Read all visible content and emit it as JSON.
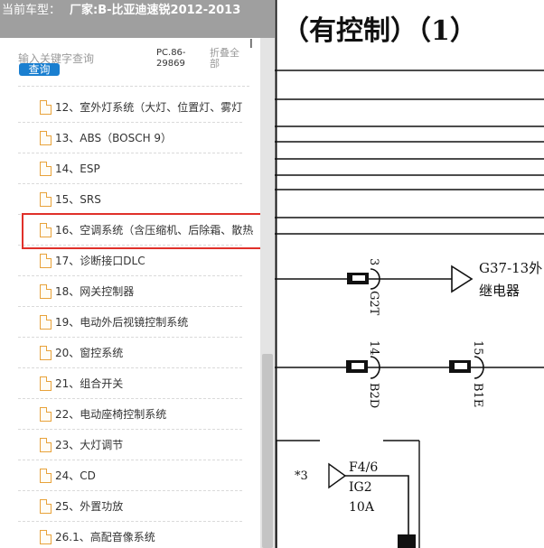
{
  "window": {
    "title_prefix": "当前车型：",
    "car_model": "厂家:B-比亚迪速锐2012-2013"
  },
  "search": {
    "placeholder": "输入关键字查询",
    "button_label": "查询",
    "pc_code": "PC.86-29869",
    "collapse_all": "折叠全部",
    "bar_glyph": "I"
  },
  "tree_items": [
    {
      "label": "12、室外灯系统（大灯、位置灯、雾灯"
    },
    {
      "label": "13、ABS（BOSCH 9）"
    },
    {
      "label": "14、ESP"
    },
    {
      "label": "15、SRS"
    },
    {
      "label": "16、空调系统（含压缩机、后除霜、散热"
    },
    {
      "label": "17、诊断接口DLC"
    },
    {
      "label": "18、网关控制器"
    },
    {
      "label": "19、电动外后视镜控制系统"
    },
    {
      "label": "20、窗控系统"
    },
    {
      "label": "21、组合开关"
    },
    {
      "label": "22、电动座椅控制系统"
    },
    {
      "label": "23、大灯调节"
    },
    {
      "label": "24、CD"
    },
    {
      "label": "25、外置功放"
    },
    {
      "label": "26.1、高配音像系统"
    }
  ],
  "selected_index": 4,
  "colors": {
    "title_bar": "#9f9f9f",
    "search_button": "#1a7fd0",
    "highlight": "#e0302a",
    "doc_icon": "#e8a23a"
  },
  "diagram": {
    "header_fragment": "（有控制）（1）",
    "pin_3": "3",
    "pin_14": "14",
    "pin_15": "15",
    "conn_g2t": "G2T",
    "conn_b2d": "B2D",
    "conn_b1e": "B1E",
    "relay_label_1": "G37-13外",
    "relay_label_2": "继电器",
    "mark_star3": "*3",
    "fuse_f46": "F4/6",
    "fuse_ig2": "IG2",
    "fuse_10a": "10A"
  }
}
